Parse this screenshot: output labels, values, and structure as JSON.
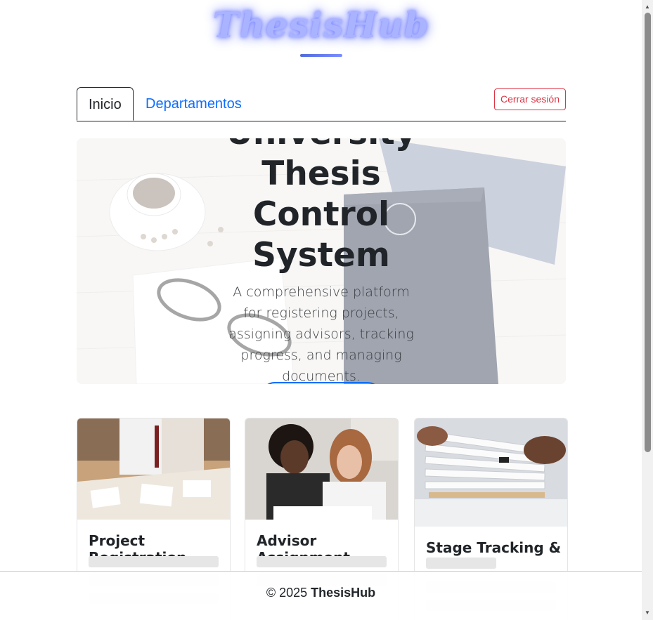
{
  "header": {
    "brand": "ThesisHub"
  },
  "tabs": [
    {
      "label": "Inicio",
      "active": true
    },
    {
      "label": "Departamentos",
      "active": false
    }
  ],
  "logout_label": "Cerrar sesión",
  "hero": {
    "title_lines": [
      "University",
      "Thesis",
      "Control",
      "System"
    ],
    "subtitle": "A comprehensive platform for registering projects, assigning advisors, tracking progress, and managing documents."
  },
  "cards": [
    {
      "title": "Project Registration"
    },
    {
      "title": "Advisor Assignment"
    },
    {
      "title": "Stage Tracking &"
    }
  ],
  "footer": {
    "prefix": "© 2025 ",
    "brand": "ThesisHub"
  },
  "colors": {
    "accent": "#0d6efd",
    "danger": "#dc3545",
    "brand_glow": "#6f7cff"
  }
}
